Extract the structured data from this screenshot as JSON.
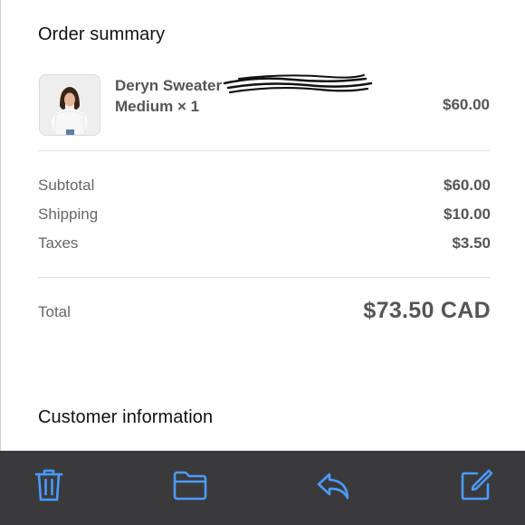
{
  "order_summary": {
    "title": "Order summary",
    "item": {
      "name": "Deryn Sweater",
      "variant": "Medium × 1",
      "price": "$60.00"
    },
    "lines": [
      {
        "label": "Subtotal",
        "value": "$60.00"
      },
      {
        "label": "Shipping",
        "value": "$10.00"
      },
      {
        "label": "Taxes",
        "value": "$3.50"
      }
    ],
    "total": {
      "label": "Total",
      "value": "$73.50 CAD"
    }
  },
  "customer_information": {
    "title": "Customer information"
  },
  "toolbar": {
    "icons": [
      "trash-icon",
      "folder-icon",
      "reply-icon",
      "compose-icon"
    ],
    "accent_color": "#4a9bff",
    "background": "#3a3a3c"
  }
}
